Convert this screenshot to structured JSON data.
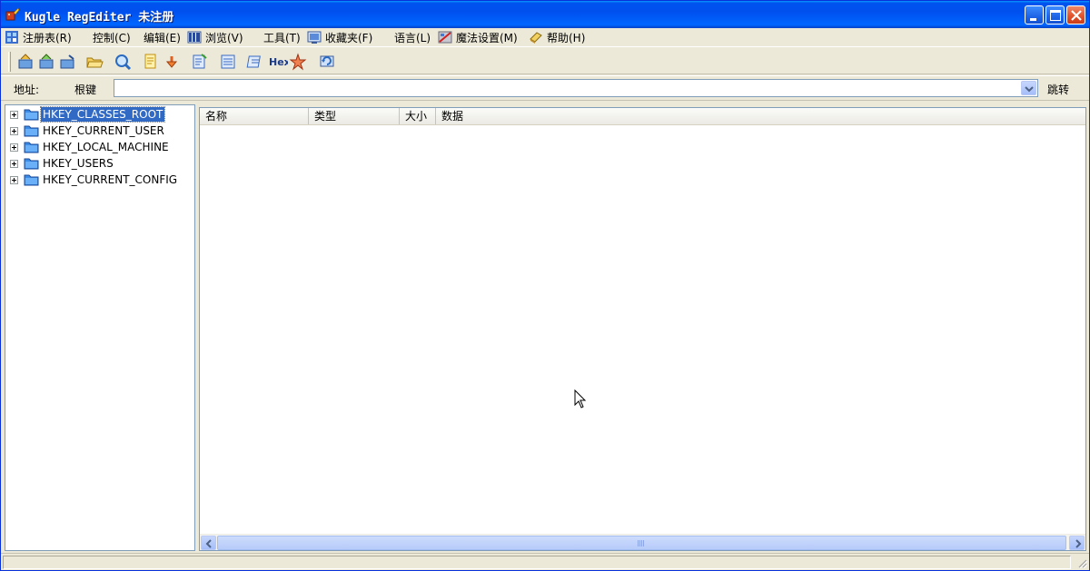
{
  "window": {
    "title": "Kugle RegEditer 未注册"
  },
  "menu": [
    {
      "label": "注册表(R)",
      "icon": "registry-icon"
    },
    {
      "label": "控制(C)"
    },
    {
      "label": "编辑(E)"
    },
    {
      "label": "浏览(V)",
      "icon": "view-columns-icon"
    },
    {
      "label": "工具(T)"
    },
    {
      "label": "收藏夹(F)",
      "icon": "favorites-icon"
    },
    {
      "label": "语言(L)"
    },
    {
      "label": "魔法设置(M)",
      "icon": "magic-settings-icon"
    },
    {
      "label": "帮助(H)",
      "icon": "help-book-icon"
    }
  ],
  "toolbar": {
    "hex_label": "Hex"
  },
  "address": {
    "label": "地址:",
    "root": "根键",
    "value": "",
    "go_label": "跳转"
  },
  "tree": {
    "items": [
      {
        "label": "HKEY_CLASSES_ROOT",
        "selected": true
      },
      {
        "label": "HKEY_CURRENT_USER",
        "selected": false
      },
      {
        "label": "HKEY_LOCAL_MACHINE",
        "selected": false
      },
      {
        "label": "HKEY_USERS",
        "selected": false
      },
      {
        "label": "HKEY_CURRENT_CONFIG",
        "selected": false
      }
    ]
  },
  "list": {
    "columns": [
      "名称",
      "类型",
      "大小",
      "数据"
    ],
    "rows": []
  },
  "colors": {
    "titlebar": "#0053ee",
    "selection": "#316ac5",
    "folder": "#3c8ce6"
  }
}
